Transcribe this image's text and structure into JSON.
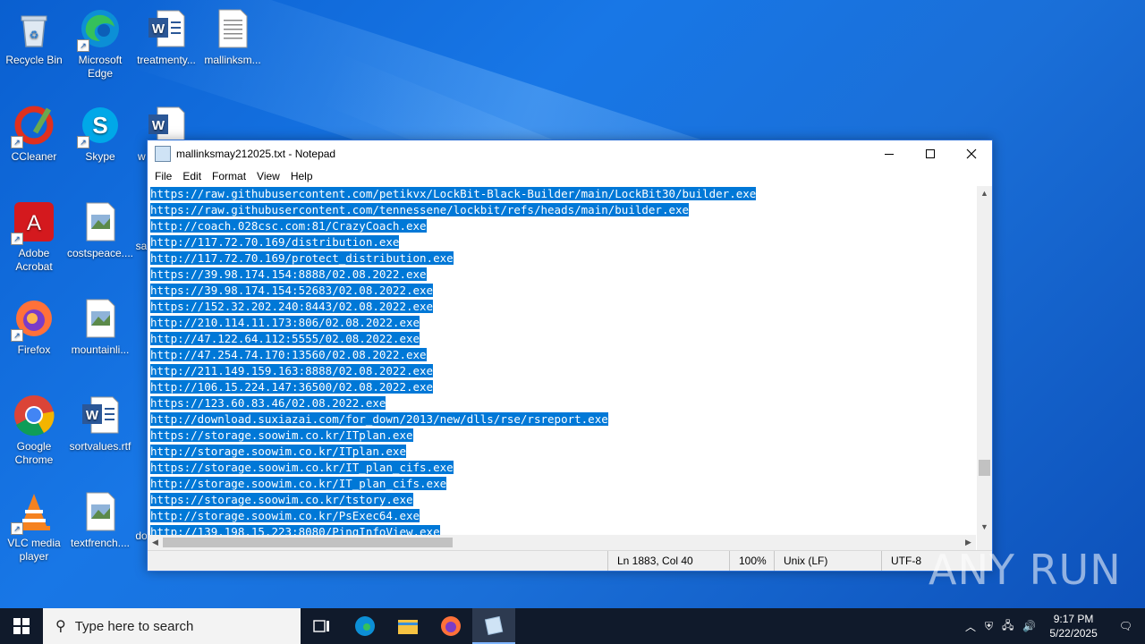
{
  "desktop": {
    "icons": [
      {
        "label": "Recycle Bin"
      },
      {
        "label": "Microsoft Edge"
      },
      {
        "label": "treatmenty..."
      },
      {
        "label": "mallinksm..."
      },
      {
        "label": "CCleaner"
      },
      {
        "label": "Skype"
      },
      {
        "label": "w"
      },
      {
        "label": "Adobe Acrobat"
      },
      {
        "label": "costspeace...."
      },
      {
        "label": "sa"
      },
      {
        "label": "Firefox"
      },
      {
        "label": "mountainli..."
      },
      {
        "label": "Google Chrome"
      },
      {
        "label": "sortvalues.rtf"
      },
      {
        "label": "VLC media player"
      },
      {
        "label": "textfrench...."
      },
      {
        "label": "do"
      }
    ]
  },
  "notepad": {
    "title": "mallinksmay212025.txt - Notepad",
    "menu": [
      "File",
      "Edit",
      "Format",
      "View",
      "Help"
    ],
    "lines": [
      "https://raw.githubusercontent.com/petikvx/LockBit-Black-Builder/main/LockBit30/builder.exe",
      "https://raw.githubusercontent.com/tennessene/lockbit/refs/heads/main/builder.exe",
      "http://coach.028csc.com:81/CrazyCoach.exe",
      "http://117.72.70.169/distribution.exe",
      "http://117.72.70.169/protect_distribution.exe",
      "https://39.98.174.154:8888/02.08.2022.exe",
      "https://39.98.174.154:52683/02.08.2022.exe",
      "https://152.32.202.240:8443/02.08.2022.exe",
      "http://210.114.11.173:806/02.08.2022.exe",
      "http://47.122.64.112:5555/02.08.2022.exe",
      "http://47.254.74.170:13560/02.08.2022.exe",
      "http://211.149.159.163:8888/02.08.2022.exe",
      "http://106.15.224.147:36500/02.08.2022.exe",
      "https://123.60.83.46/02.08.2022.exe",
      "http://download.suxiazai.com/for_down/2013/new/dlls/rse/rsreport.exe",
      "https://storage.soowim.co.kr/ITplan.exe",
      "http://storage.soowim.co.kr/ITplan.exe",
      "https://storage.soowim.co.kr/IT_plan_cifs.exe",
      "http://storage.soowim.co.kr/IT_plan_cifs.exe",
      "https://storage.soowim.co.kr/tstory.exe",
      "http://storage.soowim.co.kr/PsExec64.exe",
      "http://139.198.15.223:8080/PingInfoView.exe"
    ],
    "status": {
      "position": "Ln 1883, Col 40",
      "zoom": "100%",
      "line_ending": "Unix (LF)",
      "encoding": "UTF-8"
    }
  },
  "watermark": "ANY RUN",
  "taskbar": {
    "search_placeholder": "Type here to search",
    "time": "9:17 PM",
    "date": "5/22/2025"
  },
  "colors": {
    "selection": "#0078d7",
    "taskbar": "#101a2b"
  }
}
